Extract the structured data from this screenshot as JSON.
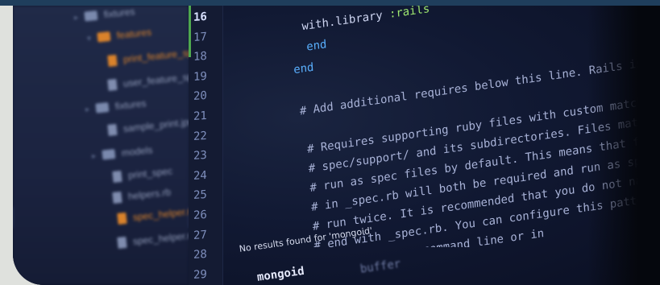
{
  "sidebar": {
    "items": [
      {
        "label": "fixtures",
        "kind": "folder"
      },
      {
        "label": "features",
        "kind": "folder-open"
      },
      {
        "label": "print_feature_spec",
        "kind": "file-ruby"
      },
      {
        "label": "user_feature_spec",
        "kind": "file"
      },
      {
        "label": "fixtures",
        "kind": "folder"
      },
      {
        "label": "sample_print.jpg",
        "kind": "file"
      },
      {
        "label": "models",
        "kind": "folder"
      },
      {
        "label": "print_spec",
        "kind": "file"
      },
      {
        "label": "helpers.rb",
        "kind": "file"
      },
      {
        "label": "spec_helper.rb",
        "kind": "file-ruby"
      },
      {
        "label": "spec_helper.rb",
        "kind": "file"
      }
    ]
  },
  "gutter": {
    "lines": [
      "16",
      "17",
      "18",
      "19",
      "20",
      "21",
      "22",
      "23",
      "24",
      "25",
      "26",
      "27",
      "28",
      "29"
    ],
    "current": "16"
  },
  "code": {
    "line1": "with.library :rails",
    "line2": "end",
    "line3": "end",
    "line4": "# Add additional requires below this line. Rails is not loaded",
    "line5": "# Requires supporting ruby files with custom matchers and macros, etc,",
    "line6": "# spec/support/ and its subdirectories. Files matching `spec/**/*_spec.rb`",
    "line7": "# run as spec files by default. This means that files in spec/support",
    "line8": "# in _spec.rb will both be required and run as specs, causing",
    "line9": "# run twice. It is recommended that you do not name files matching",
    "line10": "# end with _spec.rb. You can configure this pattern with",
    "line11": "# option on the command line or in"
  },
  "status": {
    "message": "No results found for 'mongoid'"
  },
  "bottom": {
    "word": "mongoid",
    "ghost": "buffer"
  },
  "colors": {
    "accent_orange": "#d9822b",
    "keyword_blue": "#5ab0ff",
    "symbol_green": "#9fe870",
    "active_line_marker": "#4fa84f"
  }
}
